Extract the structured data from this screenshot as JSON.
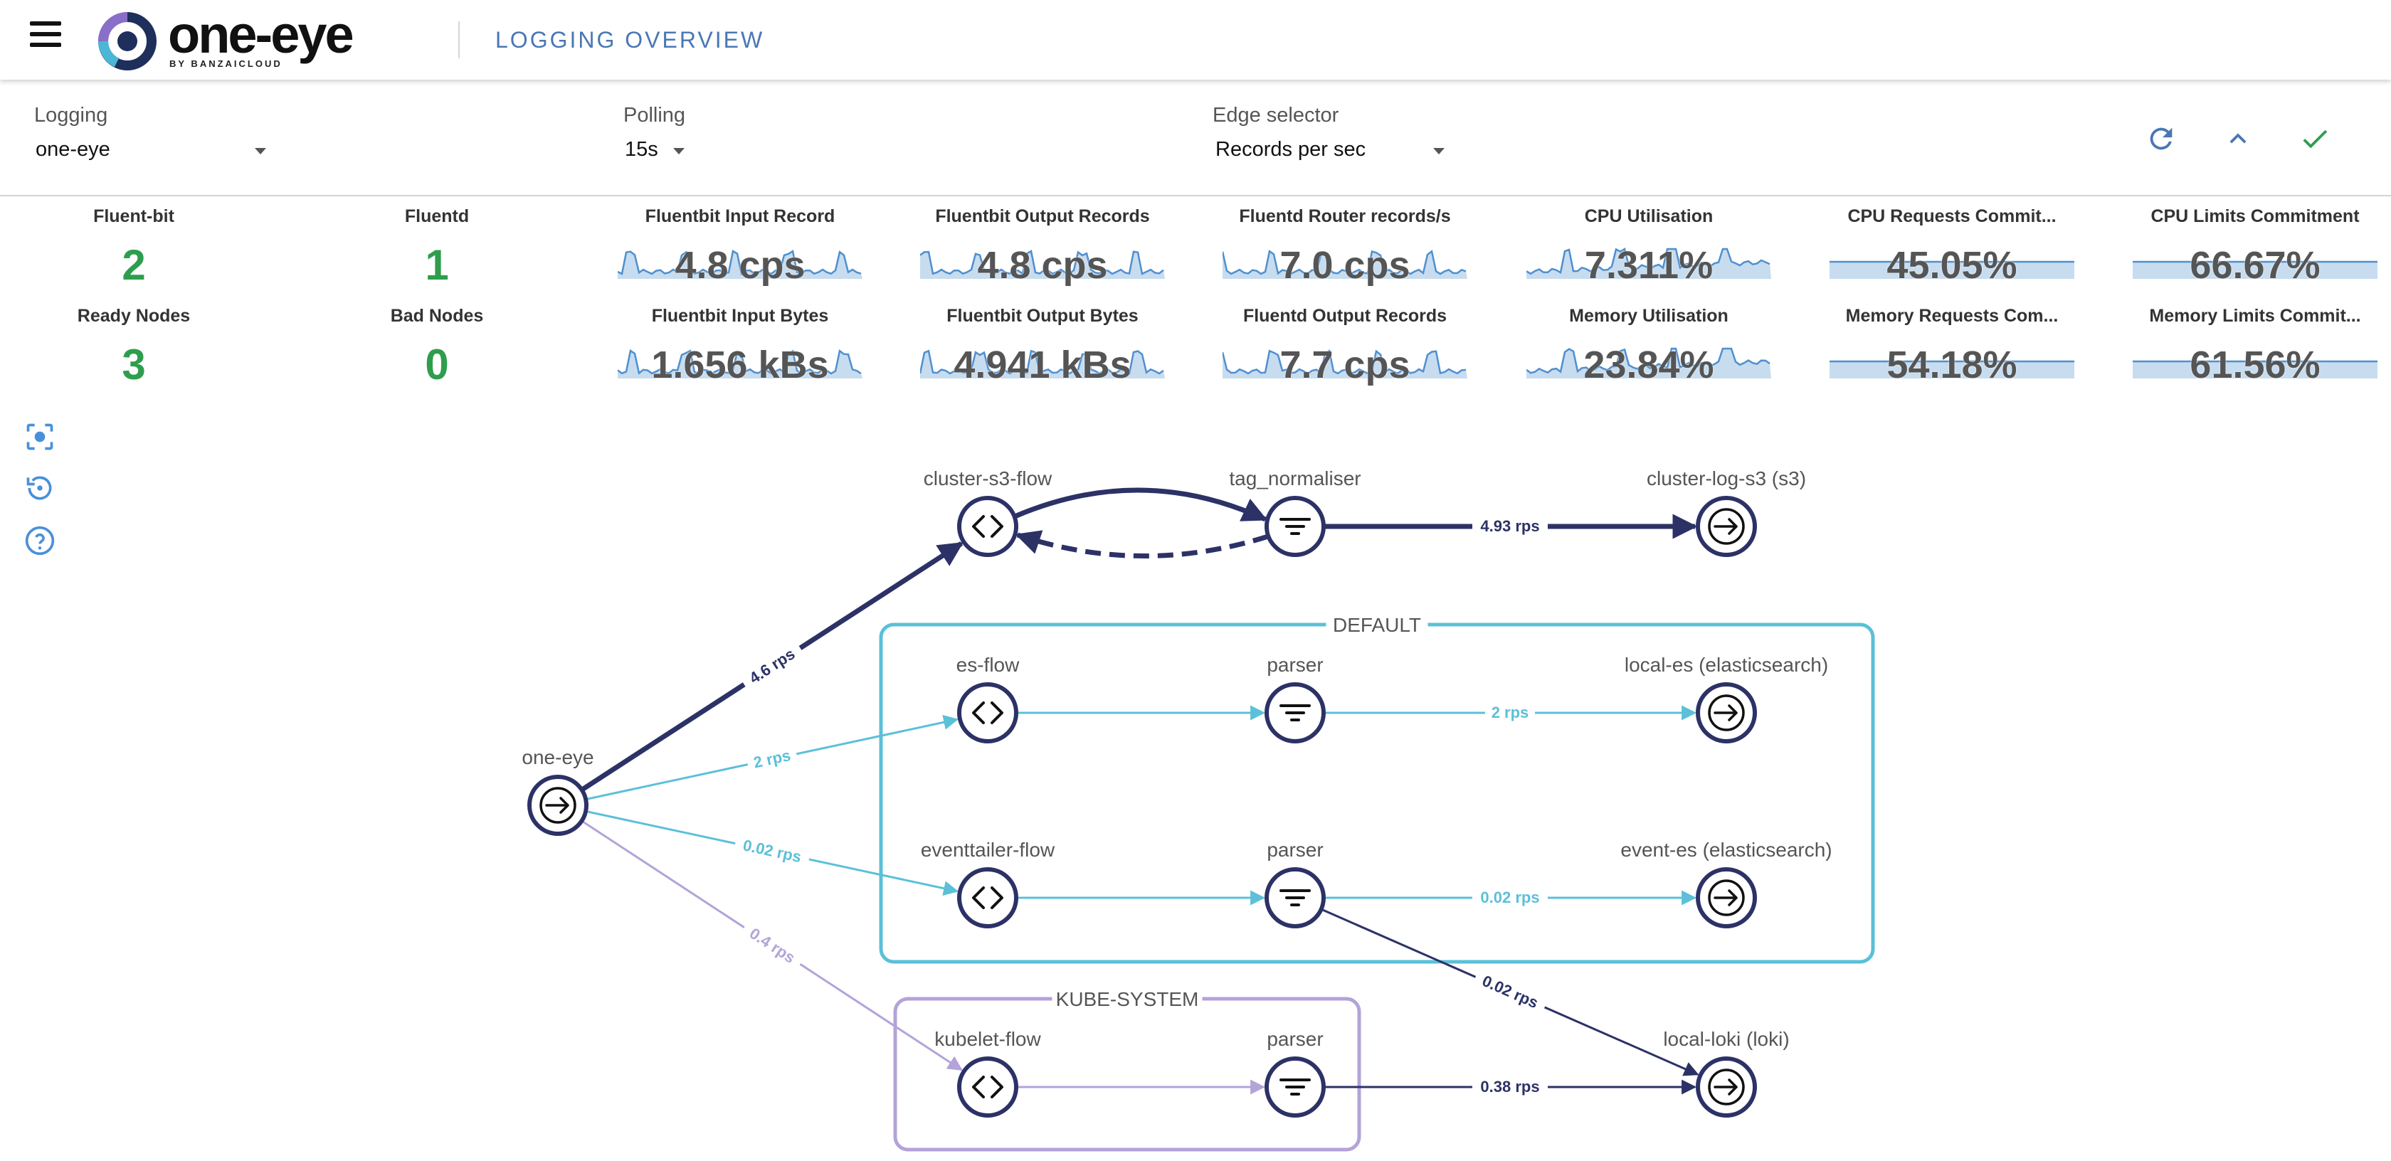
{
  "header": {
    "logo_text": "one-eye",
    "logo_sub": "BY BANZAICLOUD",
    "title": "LOGGING OVERVIEW"
  },
  "controls": {
    "logging": {
      "label": "Logging",
      "value": "one-eye"
    },
    "polling": {
      "label": "Polling",
      "value": "15s"
    },
    "edge_selector": {
      "label": "Edge selector",
      "value": "Records per sec"
    }
  },
  "stats": {
    "fluent_bit": {
      "title": "Fluent-bit",
      "value": "2"
    },
    "fluentd": {
      "title": "Fluentd",
      "value": "1"
    },
    "ready_nodes": {
      "title": "Ready Nodes",
      "value": "3"
    },
    "bad_nodes": {
      "title": "Bad Nodes",
      "value": "0"
    },
    "sparks": [
      {
        "title": "Fluentbit Input Record",
        "value": "4.8 cps"
      },
      {
        "title": "Fluentbit Output Records",
        "value": "4.8 cps"
      },
      {
        "title": "Fluentd Router records/s",
        "value": "7.0 cps"
      },
      {
        "title": "CPU Utilisation",
        "value": "7.311%"
      },
      {
        "title": "CPU Requests Commit...",
        "value": "45.05%",
        "fill": 0.4505
      },
      {
        "title": "CPU Limits Commitment",
        "value": "66.67%",
        "fill": 0.6667
      },
      {
        "title": "Fluentbit Input Bytes",
        "value": "1.656 kBs"
      },
      {
        "title": "Fluentbit Output Bytes",
        "value": "4.941 kBs"
      },
      {
        "title": "Fluentd Output Records",
        "value": "7.7 cps"
      },
      {
        "title": "Memory Utilisation",
        "value": "23.84%"
      },
      {
        "title": "Memory Requests Com...",
        "value": "54.18%",
        "fill": 0.5418
      },
      {
        "title": "Memory Limits Commit...",
        "value": "61.56%",
        "fill": 0.6156
      }
    ]
  },
  "graph": {
    "groups": [
      {
        "id": "default",
        "label": "DEFAULT"
      },
      {
        "id": "kube-system",
        "label": "KUBE-SYSTEM"
      }
    ],
    "nodes": [
      {
        "id": "one-eye",
        "label": "one-eye",
        "icon": "input-arrow-icon"
      },
      {
        "id": "cluster-s3-flow",
        "label": "cluster-s3-flow",
        "icon": "code-brackets-icon"
      },
      {
        "id": "tag_normaliser",
        "label": "tag_normaliser",
        "icon": "filter-icon"
      },
      {
        "id": "cluster-log-s3",
        "label": "cluster-log-s3 (s3)",
        "icon": "output-arrow-icon"
      },
      {
        "id": "es-flow",
        "label": "es-flow",
        "icon": "code-brackets-icon"
      },
      {
        "id": "parser-es",
        "label": "parser",
        "icon": "filter-icon"
      },
      {
        "id": "local-es",
        "label": "local-es (elasticsearch)",
        "icon": "output-arrow-icon"
      },
      {
        "id": "eventtailer-flow",
        "label": "eventtailer-flow",
        "icon": "code-brackets-icon"
      },
      {
        "id": "parser-event",
        "label": "parser",
        "icon": "filter-icon"
      },
      {
        "id": "event-es",
        "label": "event-es (elasticsearch)",
        "icon": "output-arrow-icon"
      },
      {
        "id": "kubelet-flow",
        "label": "kubelet-flow",
        "icon": "code-brackets-icon"
      },
      {
        "id": "parser-kube",
        "label": "parser",
        "icon": "filter-icon"
      },
      {
        "id": "local-loki",
        "label": "local-loki (loki)",
        "icon": "output-arrow-icon"
      }
    ],
    "edges": [
      {
        "from": "one-eye",
        "to": "cluster-s3-flow",
        "label": "4.6 rps"
      },
      {
        "from": "one-eye",
        "to": "es-flow",
        "label": "2 rps"
      },
      {
        "from": "one-eye",
        "to": "eventtailer-flow",
        "label": "0.02 rps"
      },
      {
        "from": "one-eye",
        "to": "kubelet-flow",
        "label": "0.4 rps"
      },
      {
        "from": "cluster-s3-flow",
        "to": "tag_normaliser",
        "label": ""
      },
      {
        "from": "tag_normaliser",
        "to": "cluster-s3-flow",
        "label": ""
      },
      {
        "from": "tag_normaliser",
        "to": "cluster-log-s3",
        "label": "4.93 rps"
      },
      {
        "from": "es-flow",
        "to": "parser-es",
        "label": ""
      },
      {
        "from": "parser-es",
        "to": "local-es",
        "label": "2 rps"
      },
      {
        "from": "eventtailer-flow",
        "to": "parser-event",
        "label": ""
      },
      {
        "from": "parser-event",
        "to": "event-es",
        "label": "0.02 rps"
      },
      {
        "from": "parser-event",
        "to": "local-loki",
        "label": "0.02 rps"
      },
      {
        "from": "kubelet-flow",
        "to": "parser-kube",
        "label": ""
      },
      {
        "from": "parser-kube",
        "to": "local-loki",
        "label": "0.38 rps"
      }
    ]
  },
  "colors": {
    "accent": "#4a77b4",
    "green": "#2e9e4d",
    "navy": "#2c3266",
    "cyan": "#5bc0d8",
    "lavender": "#b3a3d9",
    "spark_line": "#4f8fcf",
    "spark_fill": "#c7dcef"
  }
}
